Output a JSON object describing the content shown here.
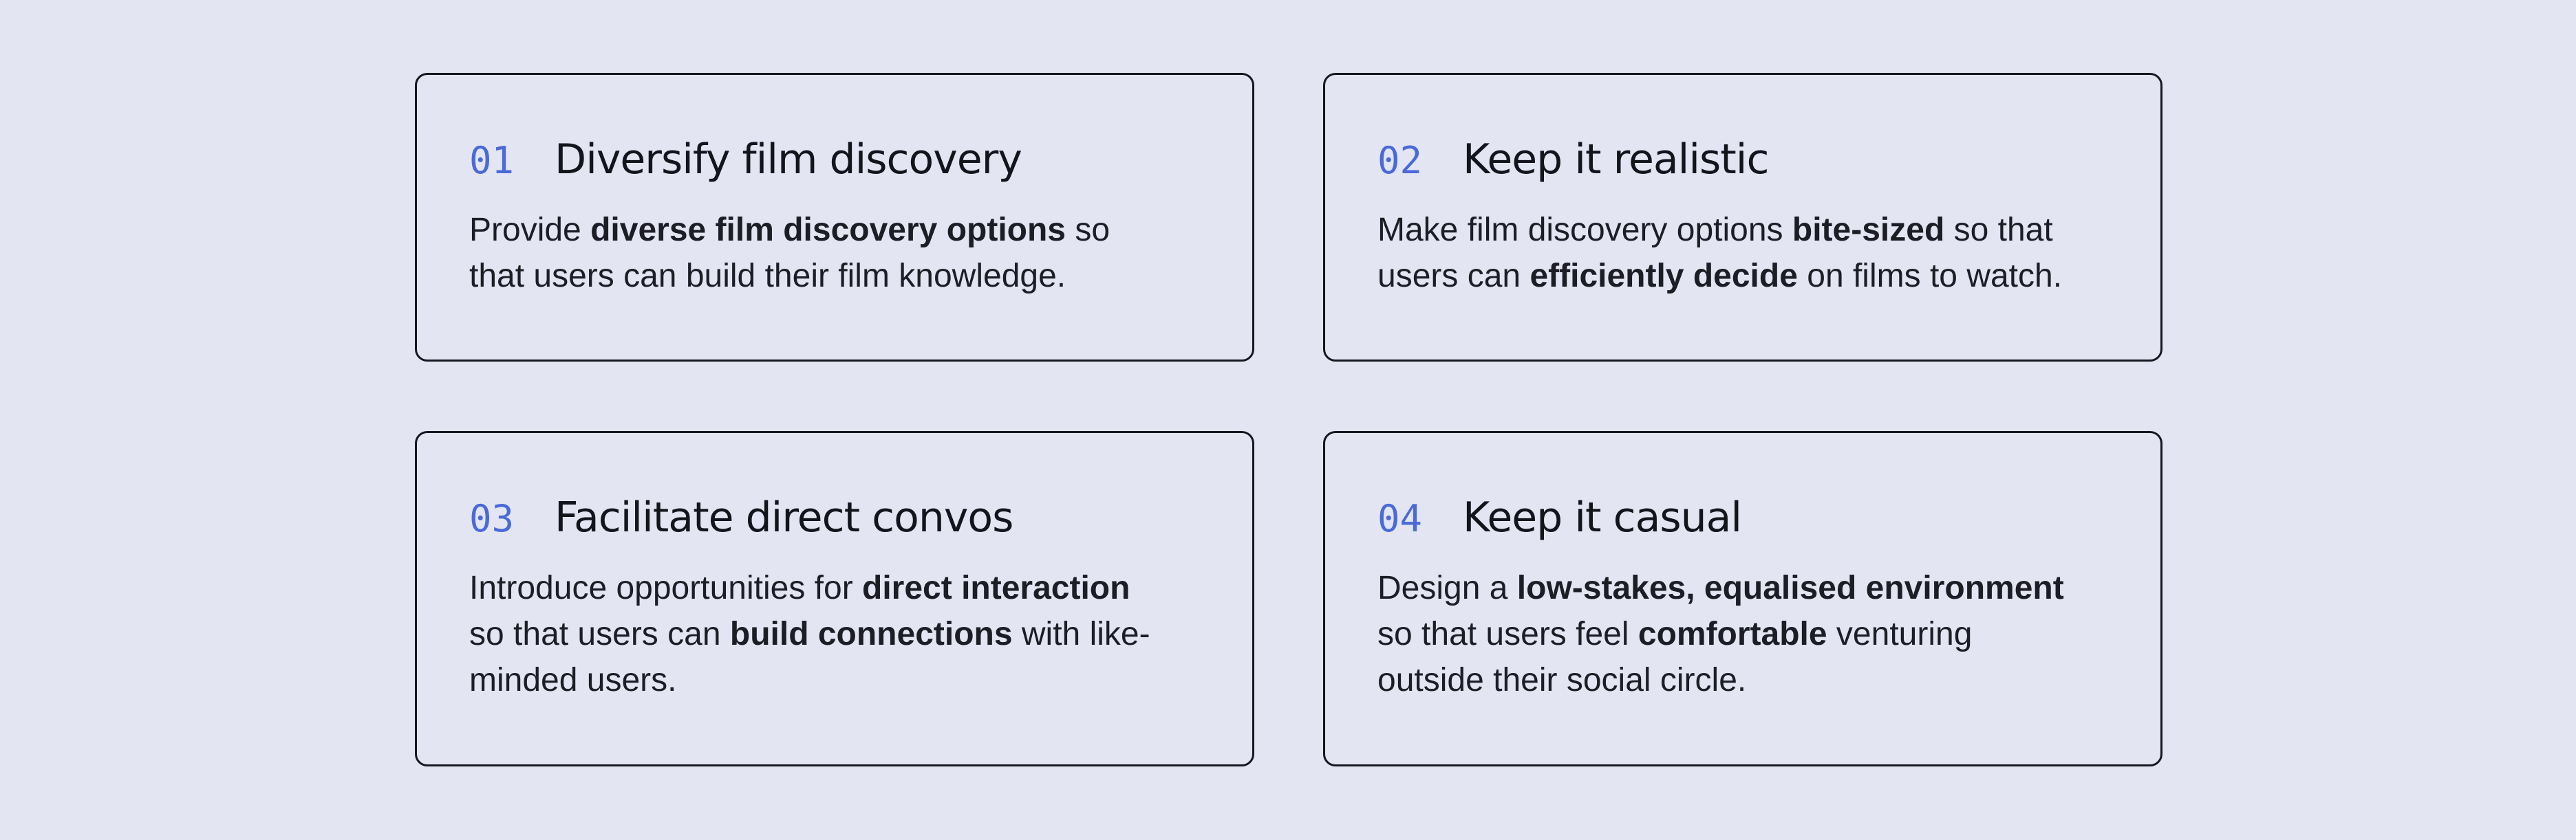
{
  "cards": [
    {
      "number": "01",
      "title": "Diversify film discovery",
      "body": [
        {
          "text": "Provide ",
          "bold": false
        },
        {
          "text": "diverse film discovery options",
          "bold": true
        },
        {
          "text": " so that users can build their film knowledge.",
          "bold": false
        }
      ]
    },
    {
      "number": "02",
      "title": "Keep it realistic",
      "body": [
        {
          "text": "Make film discovery options ",
          "bold": false
        },
        {
          "text": "bite-sized",
          "bold": true
        },
        {
          "text": " so that users can ",
          "bold": false
        },
        {
          "text": "efficiently decide",
          "bold": true
        },
        {
          "text": " on films to watch.",
          "bold": false
        }
      ]
    },
    {
      "number": "03",
      "title": "Facilitate direct convos",
      "body": [
        {
          "text": "Introduce opportunities for ",
          "bold": false
        },
        {
          "text": "direct interaction",
          "bold": true
        },
        {
          "text": " so that users can ",
          "bold": false
        },
        {
          "text": "build connections",
          "bold": true
        },
        {
          "text": " with like-minded users.",
          "bold": false
        }
      ]
    },
    {
      "number": "04",
      "title": "Keep it casual",
      "body": [
        {
          "text": "Design a ",
          "bold": false
        },
        {
          "text": "low-stakes, equalised environment",
          "bold": true
        },
        {
          "text": " so that users feel ",
          "bold": false
        },
        {
          "text": "comfortable",
          "bold": true
        },
        {
          "text": " venturing outside their social circle.",
          "bold": false
        }
      ]
    }
  ],
  "colors": {
    "background": "#e3e5f2",
    "number_accent": "#4a6ad8",
    "text": "#14141c",
    "border": "#17171f"
  }
}
